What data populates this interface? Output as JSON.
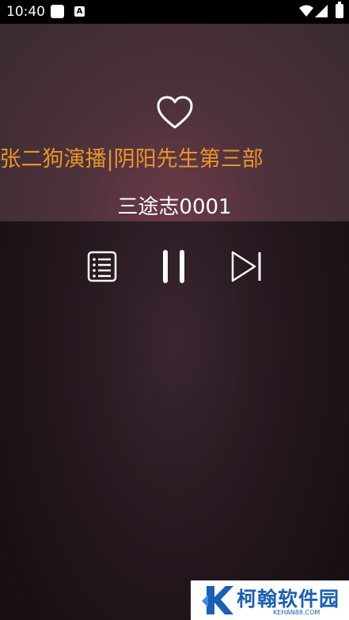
{
  "status_bar": {
    "time": "10:40",
    "a_icon_label": "A"
  },
  "player": {
    "album_title": "l张二狗演播|阴阳先生第三部",
    "track_title": "三途志0001",
    "accent_color": "#e8952a"
  },
  "icons": {
    "favorite": "heart-outline-icon",
    "playlist": "playlist-icon",
    "pause": "pause-icon",
    "next": "skip-next-icon"
  },
  "watermark": {
    "brand": "柯翰软件园",
    "domain": "KEHAN88.COM"
  }
}
